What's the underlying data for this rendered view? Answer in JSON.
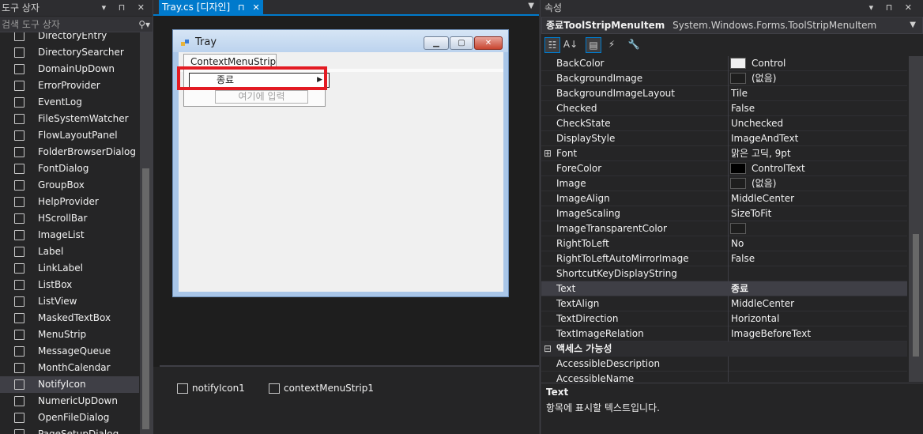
{
  "toolbox": {
    "title": "도구 상자",
    "title_icons": "▾ ⊓ ✕",
    "search_placeholder": "검색 도구 상자",
    "items": [
      {
        "label": "DirectoryEntry",
        "icon": "directory-entry-icon"
      },
      {
        "label": "DirectorySearcher",
        "icon": "directory-searcher-icon"
      },
      {
        "label": "DomainUpDown",
        "icon": "domain-updown-icon"
      },
      {
        "label": "ErrorProvider",
        "icon": "error-provider-icon"
      },
      {
        "label": "EventLog",
        "icon": "event-log-icon"
      },
      {
        "label": "FileSystemWatcher",
        "icon": "file-system-watcher-icon"
      },
      {
        "label": "FlowLayoutPanel",
        "icon": "flow-layout-panel-icon"
      },
      {
        "label": "FolderBrowserDialog",
        "icon": "folder-browser-dialog-icon"
      },
      {
        "label": "FontDialog",
        "icon": "font-dialog-icon"
      },
      {
        "label": "GroupBox",
        "icon": "group-box-icon"
      },
      {
        "label": "HelpProvider",
        "icon": "help-provider-icon"
      },
      {
        "label": "HScrollBar",
        "icon": "hscrollbar-icon"
      },
      {
        "label": "ImageList",
        "icon": "image-list-icon"
      },
      {
        "label": "Label",
        "icon": "label-icon"
      },
      {
        "label": "LinkLabel",
        "icon": "link-label-icon"
      },
      {
        "label": "ListBox",
        "icon": "list-box-icon"
      },
      {
        "label": "ListView",
        "icon": "list-view-icon"
      },
      {
        "label": "MaskedTextBox",
        "icon": "masked-text-box-icon"
      },
      {
        "label": "MenuStrip",
        "icon": "menu-strip-icon"
      },
      {
        "label": "MessageQueue",
        "icon": "message-queue-icon"
      },
      {
        "label": "MonthCalendar",
        "icon": "month-calendar-icon"
      },
      {
        "label": "NotifyIcon",
        "icon": "notify-icon-icon"
      },
      {
        "label": "NumericUpDown",
        "icon": "numeric-updown-icon"
      },
      {
        "label": "OpenFileDialog",
        "icon": "open-file-dialog-icon"
      },
      {
        "label": "PageSetupDialog",
        "icon": "page-setup-dialog-icon"
      }
    ],
    "selected_index": 21
  },
  "designer": {
    "tab_label": "Tray.cs [디자인]",
    "tab_pin": "⊓",
    "tab_close": "✕",
    "form": {
      "title": "Tray",
      "context_menu_strip": "ContextMenuStrip",
      "menu_item": "종료",
      "type_here": "여기에 입력"
    },
    "tray_components": [
      {
        "label": "notifyIcon1",
        "icon": "notify-icon-component-icon"
      },
      {
        "label": "contextMenuStrip1",
        "icon": "context-menu-strip-component-icon"
      }
    ]
  },
  "properties": {
    "title": "속성",
    "object_name": "종료ToolStripMenuItem",
    "object_type": "System.Windows.Forms.ToolStripMenuItem",
    "rows": [
      {
        "name": "BackColor",
        "value": "Control",
        "swatch": "#f0f0f0"
      },
      {
        "name": "BackgroundImage",
        "value": "(없음)",
        "swatch": "#1e1e1e"
      },
      {
        "name": "BackgroundImageLayout",
        "value": "Tile"
      },
      {
        "name": "Checked",
        "value": "False"
      },
      {
        "name": "CheckState",
        "value": "Unchecked"
      },
      {
        "name": "DisplayStyle",
        "value": "ImageAndText"
      },
      {
        "name": "Font",
        "value": "맑은 고딕, 9pt",
        "expander": "⊞"
      },
      {
        "name": "ForeColor",
        "value": "ControlText",
        "swatch": "#000000"
      },
      {
        "name": "Image",
        "value": "(없음)",
        "swatch": "#1e1e1e"
      },
      {
        "name": "ImageAlign",
        "value": "MiddleCenter"
      },
      {
        "name": "ImageScaling",
        "value": "SizeToFit"
      },
      {
        "name": "ImageTransparentColor",
        "value": "",
        "swatch": "#1e1e1e"
      },
      {
        "name": "RightToLeft",
        "value": "No"
      },
      {
        "name": "RightToLeftAutoMirrorImage",
        "value": "False"
      },
      {
        "name": "ShortcutKeyDisplayString",
        "value": ""
      },
      {
        "name": "Text",
        "value": "종료",
        "bold": true,
        "selected": true
      },
      {
        "name": "TextAlign",
        "value": "MiddleCenter"
      },
      {
        "name": "TextDirection",
        "value": "Horizontal"
      },
      {
        "name": "TextImageRelation",
        "value": "ImageBeforeText"
      },
      {
        "name": "액세스 가능성",
        "value": "",
        "category": true,
        "expander": "⊟"
      },
      {
        "name": "AccessibleDescription",
        "value": ""
      },
      {
        "name": "AccessibleName",
        "value": ""
      }
    ],
    "description_title": "Text",
    "description_text": "항목에 표시할 텍스트입니다."
  }
}
